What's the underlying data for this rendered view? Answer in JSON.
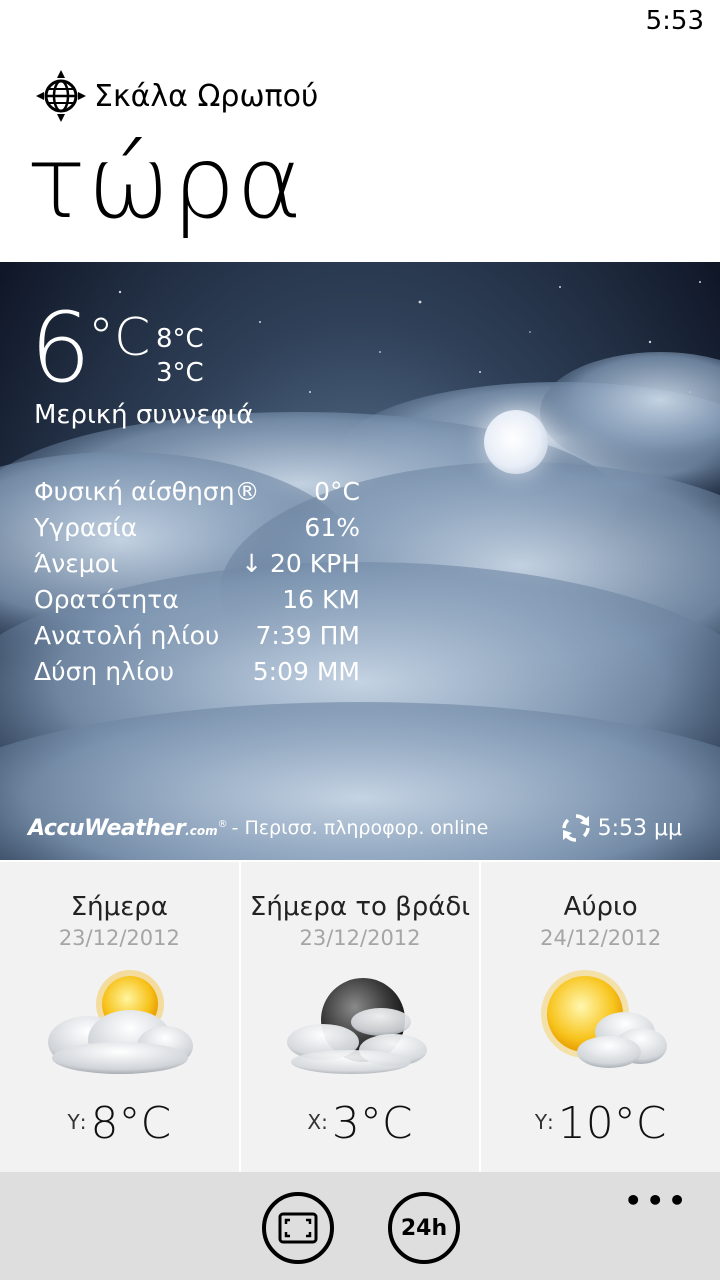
{
  "status": {
    "time": "5:53"
  },
  "location": {
    "name": "Σκάλα Ωρωπού"
  },
  "page_title": "τώρα",
  "current": {
    "temp_value": "6",
    "temp_unit": "°C",
    "high": "8°C",
    "low": "3°C",
    "condition": "Μερική συννεφιά",
    "details": [
      {
        "label": "Φυσική αίσθηση®",
        "value": "0°C"
      },
      {
        "label": "Υγρασία",
        "value": "61%"
      },
      {
        "label": "Άνεμοι",
        "value": "↓ 20 ΚΡΗ"
      },
      {
        "label": "Ορατότητα",
        "value": "16 ΚΜ"
      },
      {
        "label": "Ανατολή ηλίου",
        "value": "7:39 ΠΜ"
      },
      {
        "label": "Δύση ηλίου",
        "value": "5:09 ΜΜ"
      }
    ]
  },
  "footer": {
    "brand": "AccuWeather",
    "brand_suffix": ".com",
    "brand_reg": "®",
    "more_info": "- Περισσ. πληροφορ. online",
    "refresh_time": "5:53 μμ"
  },
  "forecast": [
    {
      "title": "Σήμερα",
      "date": "23/12/2012",
      "prefix": "Υ:",
      "temp": "8°C",
      "icon": "partly-cloudy-sun-icon"
    },
    {
      "title": "Σήμερα το βράδι",
      "date": "23/12/2012",
      "prefix": "Χ:",
      "temp": "3°C",
      "icon": "partly-cloudy-moon-icon"
    },
    {
      "title": "Αύριο",
      "date": "24/12/2012",
      "prefix": "Υ:",
      "temp": "10°C",
      "icon": "sun-cloud-icon"
    }
  ],
  "app_bar": {
    "btn_24h": "24h",
    "more": "•••"
  },
  "colors": {
    "card_bg": "#f2f2f2",
    "date_gray": "#a5a5a5",
    "app_bar_bg": "#dedede"
  }
}
